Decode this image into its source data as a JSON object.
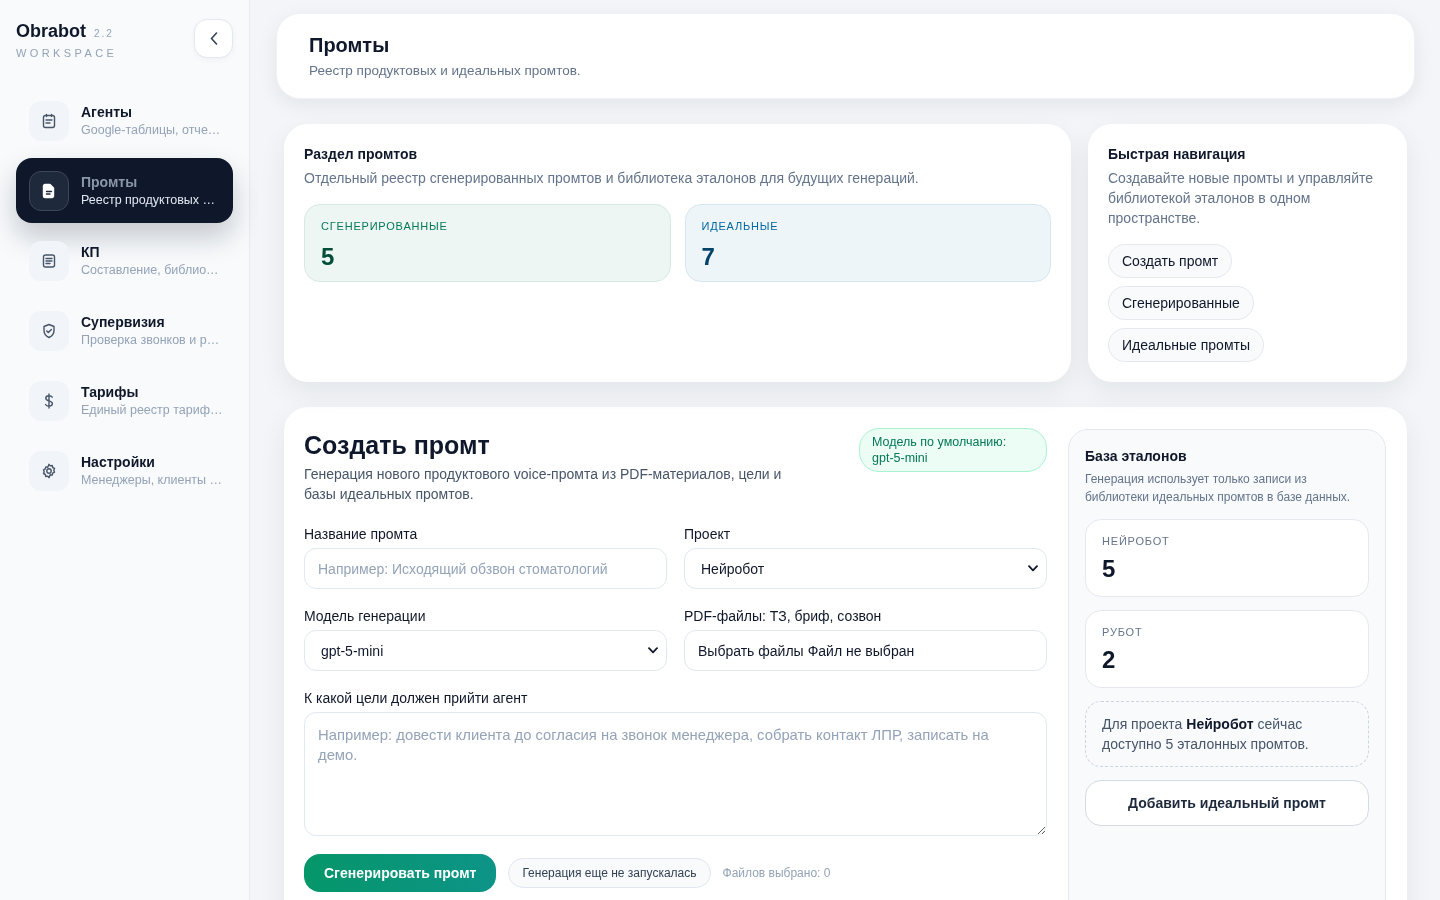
{
  "sidebar": {
    "brand": "Obrabot",
    "version": "2.2",
    "tagline": "WORKSPACE",
    "items": [
      {
        "title": "Агенты",
        "subtitle": "Google-таблицы, отче…",
        "selected": false
      },
      {
        "title": "Промты",
        "subtitle": "Реестр продуктовых …",
        "selected": true
      },
      {
        "title": "КП",
        "subtitle": "Составление, библио…",
        "selected": false
      },
      {
        "title": "Супервизия",
        "subtitle": "Проверка звонков и р…",
        "selected": false
      },
      {
        "title": "Тарифы",
        "subtitle": "Единый реестр тариф…",
        "selected": false
      },
      {
        "title": "Настройки",
        "subtitle": "Менеджеры, клиенты …",
        "selected": false
      }
    ]
  },
  "header": {
    "title": "Промты",
    "subtitle": "Реестр продуктовых и идеальных промтов."
  },
  "overview": {
    "title": "Раздел промтов",
    "description": "Отдельный реестр сгенерированных промтов и библиотека эталонов для будущих генераций.",
    "stats": [
      {
        "label": "СГЕНЕРИРОВАННЫЕ",
        "value": "5",
        "color": "#047857"
      },
      {
        "label": "ИДЕАЛЬНЫЕ",
        "value": "7",
        "color": "#0369a1"
      }
    ]
  },
  "quick_nav": {
    "title": "Быстрая навигация",
    "description": "Создавайте новые промты и управляйте библиотекой эталонов в одном пространстве.",
    "links": [
      "Создать промт",
      "Сгенерированные",
      "Идеальные промты"
    ]
  },
  "create_form": {
    "title": "Создать промт",
    "description": "Генерация нового продуктового voice-промта из PDF-материалов, цели и базы идеальных промтов.",
    "badge": "Модель по умолчанию: gpt-5-mini",
    "fields": [
      {
        "kind": "text",
        "label": "Название промта",
        "placeholder": "Например: Исходящий обзвон стоматологий"
      },
      {
        "kind": "select",
        "label": "Проект",
        "value": "Нейробот"
      },
      {
        "kind": "select",
        "label": "Модель генерации",
        "value": "gpt-5-mini"
      },
      {
        "kind": "file",
        "label": "PDF-файлы: ТЗ, бриф, созвон",
        "button": "Выбрать файлы",
        "status": "Файл не выбран"
      },
      {
        "kind": "textarea",
        "label": "К какой цели должен прийти агент",
        "placeholder": "Например: довести клиента до согласия на звонок менеджера, собрать контакт ЛПР, записать на демо."
      }
    ],
    "submit": "Сгенерировать промт",
    "status": "Генерация еще не запускалась",
    "files_count": "Файлов выбрано: 0"
  },
  "library": {
    "title": "База эталонов",
    "description": "Генерация использует только записи из библиотеки идеальных промтов в базе данных.",
    "stats": [
      {
        "label": "НЕЙРОБОТ",
        "value": "5"
      },
      {
        "label": "РУБОТ",
        "value": "2"
      }
    ],
    "note": "Для проекта **Нейробот** сейчас доступно 5 эталонных промтов.",
    "button": "Добавить идеальный промт"
  }
}
